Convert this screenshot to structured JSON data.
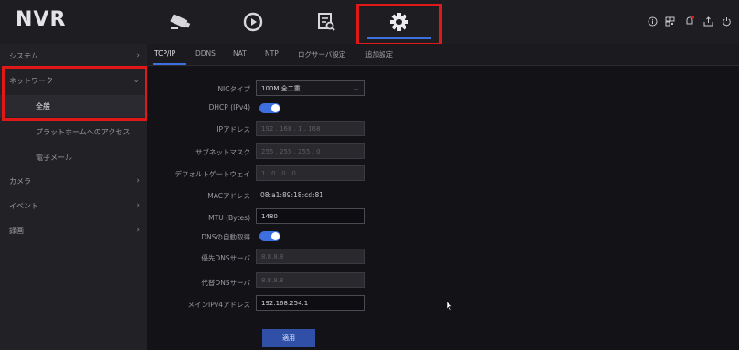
{
  "app": {
    "logo": "NVR"
  },
  "top_nav": {
    "items": [
      {
        "icon": "camera-icon"
      },
      {
        "icon": "playback-icon"
      },
      {
        "icon": "search-icon"
      },
      {
        "icon": "settings-gear-icon",
        "active": true
      }
    ],
    "system_icons": [
      "info-icon",
      "qr-icon",
      "notification-icon",
      "export-icon",
      "power-icon"
    ]
  },
  "sidebar": {
    "items": [
      {
        "label": "システム",
        "expandable": true
      },
      {
        "label": "ネットワーク",
        "expandable": true,
        "expanded": true
      },
      {
        "label": "全般",
        "selected": true
      },
      {
        "label": "プラットホームへのアクセス"
      },
      {
        "label": "電子メール"
      },
      {
        "label": "カメラ",
        "expandable": true
      },
      {
        "label": "イベント",
        "expandable": true
      },
      {
        "label": "録画",
        "expandable": true
      }
    ]
  },
  "tabs": [
    {
      "label": "TCP/IP",
      "active": true
    },
    {
      "label": "DDNS"
    },
    {
      "label": "NAT"
    },
    {
      "label": "NTP"
    },
    {
      "label": "ログサーバ設定"
    },
    {
      "label": "追加設定"
    }
  ],
  "form": {
    "nic_type": {
      "label": "NICタイプ",
      "value": "100M 全二重"
    },
    "dhcp": {
      "label": "DHCP (IPv4)",
      "enabled": true
    },
    "ip_address": {
      "label": "IPアドレス",
      "value": "192 . 168 . 1 . 168"
    },
    "subnet_mask": {
      "label": "サブネットマスク",
      "value": "255 . 255 . 255 . 0"
    },
    "gateway": {
      "label": "デフォルトゲートウェイ",
      "value": "1 . 0 . 0 . 0"
    },
    "mac": {
      "label": "MACアドレス",
      "value": "08:a1:89:18:cd:81"
    },
    "mtu": {
      "label": "MTU (Bytes)",
      "value": "1480"
    },
    "auto_dns": {
      "label": "DNSの自動取得",
      "enabled": true
    },
    "preferred_dns": {
      "label": "優先DNSサーバ",
      "value": "8.8.8.8"
    },
    "alternate_dns": {
      "label": "代替DNSサーバ",
      "value": "8.8.8.8"
    },
    "main_ipv4": {
      "label": "メインIPv4アドレス",
      "value": "192.168.254.1"
    },
    "apply_label": "適用"
  },
  "colors": {
    "accent": "#3d6fe0",
    "highlight_box": "#e01818",
    "background": "#131317"
  }
}
